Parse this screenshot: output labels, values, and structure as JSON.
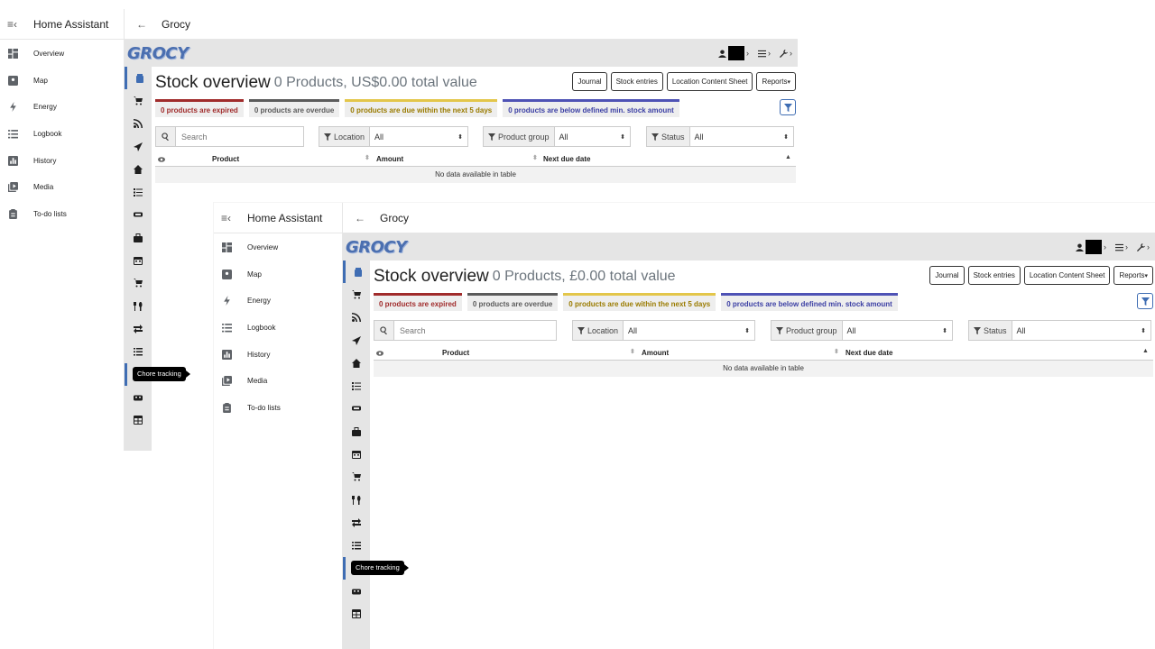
{
  "ha_sidebar": {
    "title": "Home Assistant",
    "items": [
      {
        "label": "Overview",
        "icon": "dashboard-icon"
      },
      {
        "label": "Map",
        "icon": "map-icon"
      },
      {
        "label": "Energy",
        "icon": "lightning-icon"
      },
      {
        "label": "Logbook",
        "icon": "list-icon"
      },
      {
        "label": "History",
        "icon": "chart-icon"
      },
      {
        "label": "Media",
        "icon": "media-icon"
      },
      {
        "label": "To-do lists",
        "icon": "clipboard-icon"
      }
    ]
  },
  "panel": {
    "title": "Grocy",
    "back_icon": "back-arrow-icon"
  },
  "grocy": {
    "logo": "GROCY",
    "tooltip": "Chore tracking",
    "stock_title": "Stock overview",
    "subtitle_a": "0 Products, US$0.00 total value",
    "subtitle_b": "0 Products, £0.00 total value",
    "buttons": {
      "journal": "Journal",
      "stock_entries": "Stock entries",
      "location_sheet": "Location Content Sheet",
      "reports": "Reports"
    },
    "status": {
      "expired": "0 products are expired",
      "overdue": "0 products are overdue",
      "due_soon": "0 products are due within the next 5 days",
      "below_min": "0 products are below defined min. stock amount"
    },
    "search_placeholder": "Search",
    "filters": {
      "location_label": "Location",
      "location_value": "All",
      "group_label": "Product group",
      "group_value": "All",
      "status_label": "Status",
      "status_value": "All"
    },
    "table": {
      "columns": [
        "Product",
        "Amount",
        "Next due date"
      ],
      "empty": "No data available in table"
    }
  },
  "colors": {
    "accent": "#3f6db3",
    "expired": "#a02b2b",
    "due_soon": "#e3c64a",
    "below_min": "#4e52b5"
  }
}
